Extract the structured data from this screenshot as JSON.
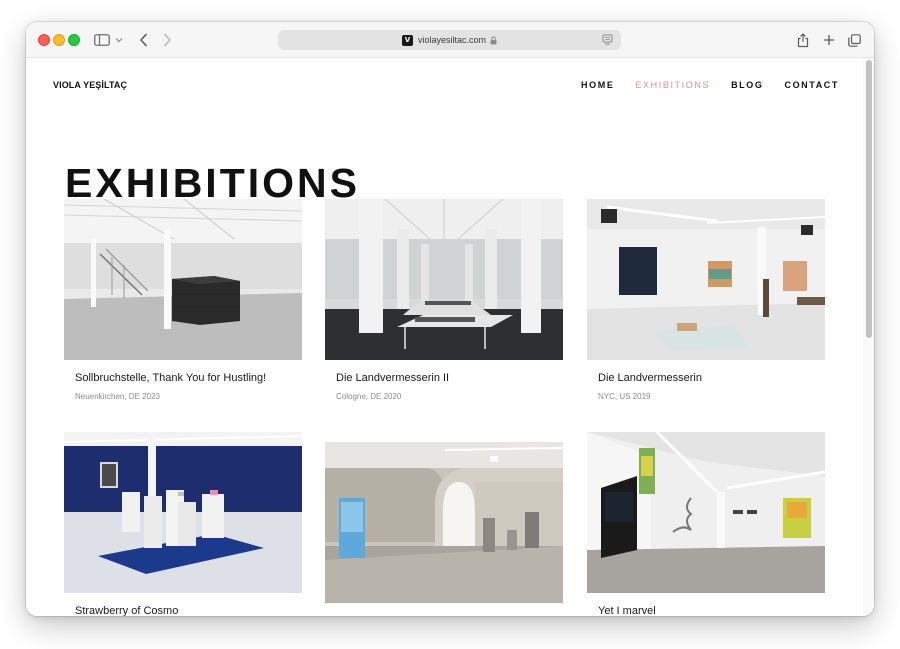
{
  "browser": {
    "url": "violayesiltac.com",
    "favicon_letter": "V",
    "icons": [
      "sidebar-icon",
      "chevron-down-icon",
      "back-arrow-icon",
      "forward-arrow-icon",
      "lock-icon",
      "reader-icon",
      "share-icon",
      "plus-icon",
      "tabs-overview-icon"
    ]
  },
  "site": {
    "logo": "VIOLA YEŞİLTAÇ",
    "nav": [
      {
        "label": "HOME",
        "active": false
      },
      {
        "label": "EXHIBITIONS",
        "active": true
      },
      {
        "label": "BLOG",
        "active": false
      },
      {
        "label": "CONTACT",
        "active": false
      }
    ],
    "accent_color": "#e5908b"
  },
  "page": {
    "title": "EXHIBITIONS"
  },
  "exhibitions": [
    {
      "title": "Sollbruchstelle, Thank You for Hustling!",
      "meta": "Neuenkirchen, DE 2023"
    },
    {
      "title": "Die Landvermesserin II",
      "meta": "Cologne, DE 2020"
    },
    {
      "title": "Die Landvermesserin",
      "meta": "NYC, US 2019"
    },
    {
      "title": "Strawberry of Cosmo",
      "meta": ""
    },
    {
      "title": "",
      "meta": ""
    },
    {
      "title": "Yet I marvel",
      "meta": ""
    }
  ]
}
